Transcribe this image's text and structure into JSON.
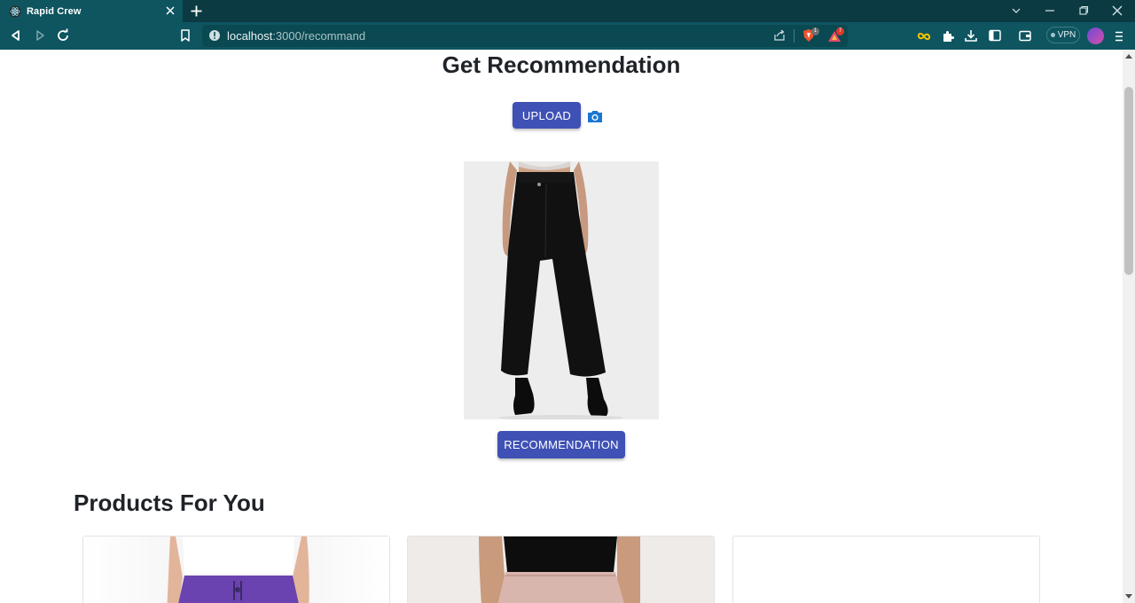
{
  "browser": {
    "tab_title": "Rapid Crew",
    "url_host": "localhost",
    "url_rest": ":3000/recommand",
    "shield_badge": "1",
    "rewards_badge": "7",
    "vpn_label": "VPN"
  },
  "page": {
    "title": "Get Recommendation",
    "upload_label": "UPLOAD",
    "recommendation_label": "RECOMMENDATION",
    "section_title": "Products For You"
  },
  "colors": {
    "primary": "#3f51b5",
    "chrome_dark": "#0b3a42",
    "chrome": "#0e5560"
  }
}
